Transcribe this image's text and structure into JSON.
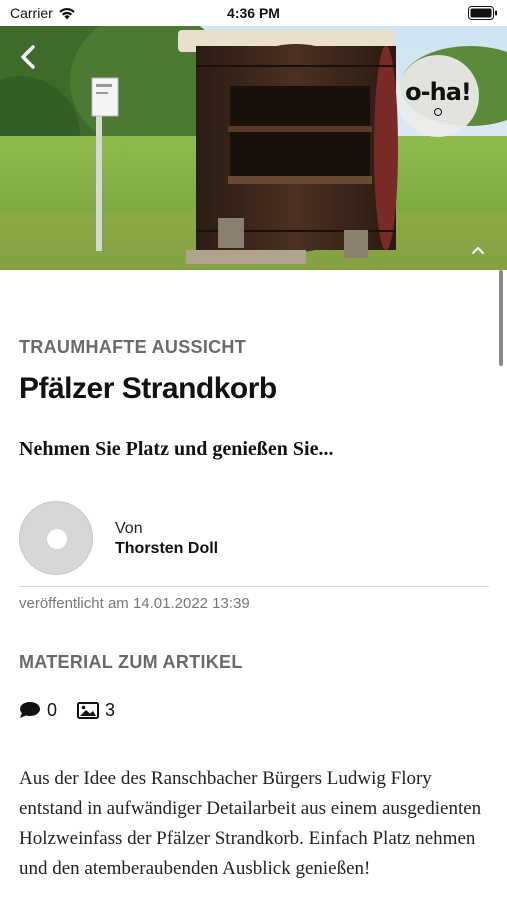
{
  "status_bar": {
    "carrier": "Carrier",
    "time": "4:36 PM"
  },
  "hero": {
    "logo_text": "o-ha!",
    "icons": [
      "back-chevron-icon",
      "chevron-up-icon"
    ]
  },
  "article": {
    "kicker": "TRAUMHAFTE AUSSICHT",
    "title": "Pfälzer Strandkorb",
    "teaser": "Nehmen Sie Platz und genießen Sie...",
    "author": {
      "prefix": "Von",
      "name": "Thorsten Doll"
    },
    "published": "veröffentlicht am 14.01.2022 13:39",
    "material_heading": "MATERIAL ZUM ARTIKEL",
    "comments_count": "0",
    "images_count": "3",
    "body": "Aus der Idee des Ranschbacher Bürgers Ludwig Flory entstand in aufwändiger Detailarbeit aus einem ausgedienten Holzweinfass der Pfälzer Strandkorb. Einfach Platz nehmen und den atemberaubenden Ausblick genießen!"
  },
  "colors": {
    "kicker": "#6a6a6a",
    "divider": "#d6d6d6",
    "meta": "#777777"
  }
}
